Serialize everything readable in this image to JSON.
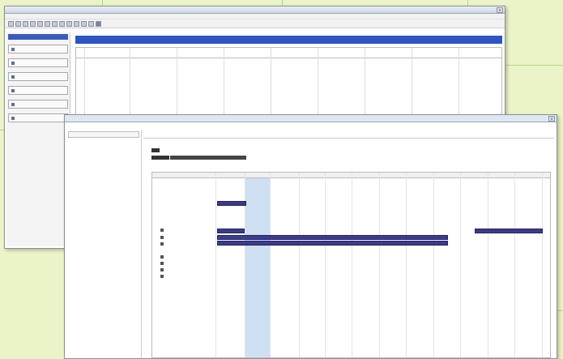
{
  "back_window": {
    "title": "",
    "menu": [
      "",
      "",
      "",
      ""
    ],
    "toolbar_icons": [
      "app-icon",
      "new-icon",
      "open-icon",
      "save-icon",
      "print-icon",
      "cut-icon",
      "copy-icon",
      "paste-icon",
      "undo-icon",
      "redo-icon",
      "refresh-icon",
      "help-icon",
      "grid-icon"
    ],
    "sidebar": {
      "header": "",
      "buttons": [
        "",
        "",
        "",
        "",
        "",
        ""
      ]
    },
    "main": {
      "banner": "",
      "columns": [
        "",
        "",
        "",
        "",
        "",
        "",
        "",
        "",
        ""
      ]
    }
  },
  "front_window": {
    "title": "",
    "tree": {
      "root": "",
      "children": [
        "",
        "",
        "",
        "",
        ""
      ]
    },
    "header": "",
    "info": {
      "line1": "",
      "field_right": ""
    },
    "gantt": {
      "rows": [
        "",
        "",
        "",
        "",
        "",
        "",
        "",
        "",
        ""
      ],
      "ticks": [
        "",
        "",
        "",
        "",
        "",
        "",
        "",
        "",
        "",
        "",
        "",
        ""
      ]
    }
  },
  "colors": {
    "background": "#eaf4c8",
    "accent_blue": "#2d55c3",
    "bar_navy": "#3b3b8f",
    "highlight": "#cfe0f3"
  }
}
